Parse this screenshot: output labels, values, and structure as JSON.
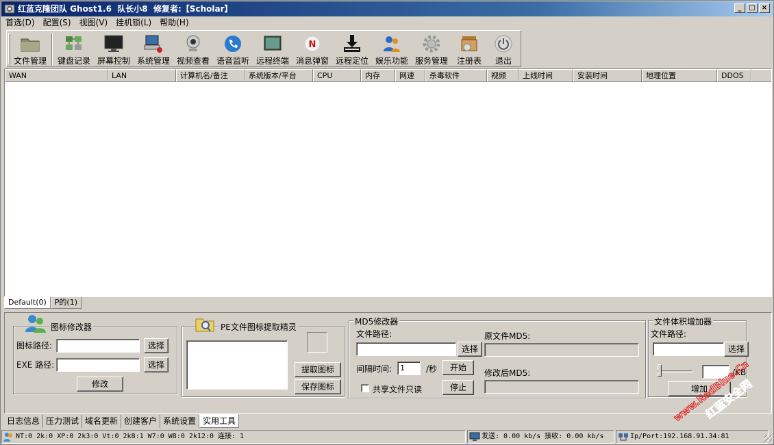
{
  "window": {
    "title": "红蓝克隆团队 Ghost1.6  队长小8  修复者:【Scholar】",
    "controls": {
      "minimize": "_",
      "maximize": "□",
      "close": "×"
    }
  },
  "menu": [
    "首选(D)",
    "配置(S)",
    "视图(V)",
    "挂机锁(L)",
    "帮助(H)"
  ],
  "toolbar": {
    "items": [
      {
        "label": "文件管理",
        "icon": "folder-icon"
      },
      {
        "label": "键盘记录",
        "icon": "keyboard-icon"
      },
      {
        "label": "屏幕控制",
        "icon": "monitor-icon"
      },
      {
        "label": "系统管理",
        "icon": "computer-icon"
      },
      {
        "label": "视频查看",
        "icon": "webcam-icon"
      },
      {
        "label": "语音监听",
        "icon": "phone-icon"
      },
      {
        "label": "远程终端",
        "icon": "terminal-icon"
      },
      {
        "label": "消息弹窗",
        "icon": "message-icon"
      },
      {
        "label": "远程定位",
        "icon": "download-icon"
      },
      {
        "label": "娱乐功能",
        "icon": "people-icon"
      },
      {
        "label": "服务管理",
        "icon": "gear-icon"
      },
      {
        "label": "注册表",
        "icon": "registry-icon"
      },
      {
        "label": "退出",
        "icon": "power-icon"
      }
    ]
  },
  "list": {
    "columns": [
      "WAN",
      "LAN",
      "计算机名/备注",
      "系统版本/平台",
      "CPU",
      "内存",
      "网速",
      "杀毒软件",
      "视频",
      "上线时间",
      "安装时间",
      "地理位置",
      "DDOS"
    ]
  },
  "groups": [
    "Default(0)",
    "P的(1)"
  ],
  "icon_modifier": {
    "title": "图标修改器",
    "icon_path_label": "图标路径:",
    "exe_path_label": "EXE 路径:",
    "select1": "选择",
    "select2": "选择",
    "modify": "修改"
  },
  "pe_extractor": {
    "title": "PE文件图标提取精灵",
    "extract": "提取图标",
    "save": "保存图标"
  },
  "md5": {
    "title": "MD5修改器",
    "file_path_label": "文件路径:",
    "select": "选择",
    "orig_label": "原文件MD5:",
    "interval_label": "间隔时间:",
    "interval_value": "1",
    "per_sec": "/秒",
    "start": "开始",
    "modified_label": "修改后MD5:",
    "shared_readonly": "共享文件只读",
    "stop": "停止"
  },
  "size_increaser": {
    "title": "文件体积增加器",
    "file_path_label": "文件路径:",
    "select": "选择",
    "unit": "/KB",
    "add": "增加"
  },
  "bottom_tabs": [
    "日志信息",
    "压力测试",
    "域名更新",
    "创建客户",
    "系统设置",
    "实用工具"
  ],
  "status": {
    "os_counts": "NT:0 2k:0 XP:0 2k3:0 Vt:0 2k8:1 W7:0 W8:0 2k12:0  连接: 1",
    "traffic": "发送: 0.00 kb/s 接收: 0.00 kb/s",
    "ip_port": "Ip/Port:192.168.91.34:81"
  },
  "watermark": {
    "line1": "www.RedBlue.Cn",
    "line2": "红蓝安全网"
  },
  "colors": {
    "title_start": "#0a246a",
    "title_end": "#a6caf0",
    "watermark": "#e02020"
  }
}
